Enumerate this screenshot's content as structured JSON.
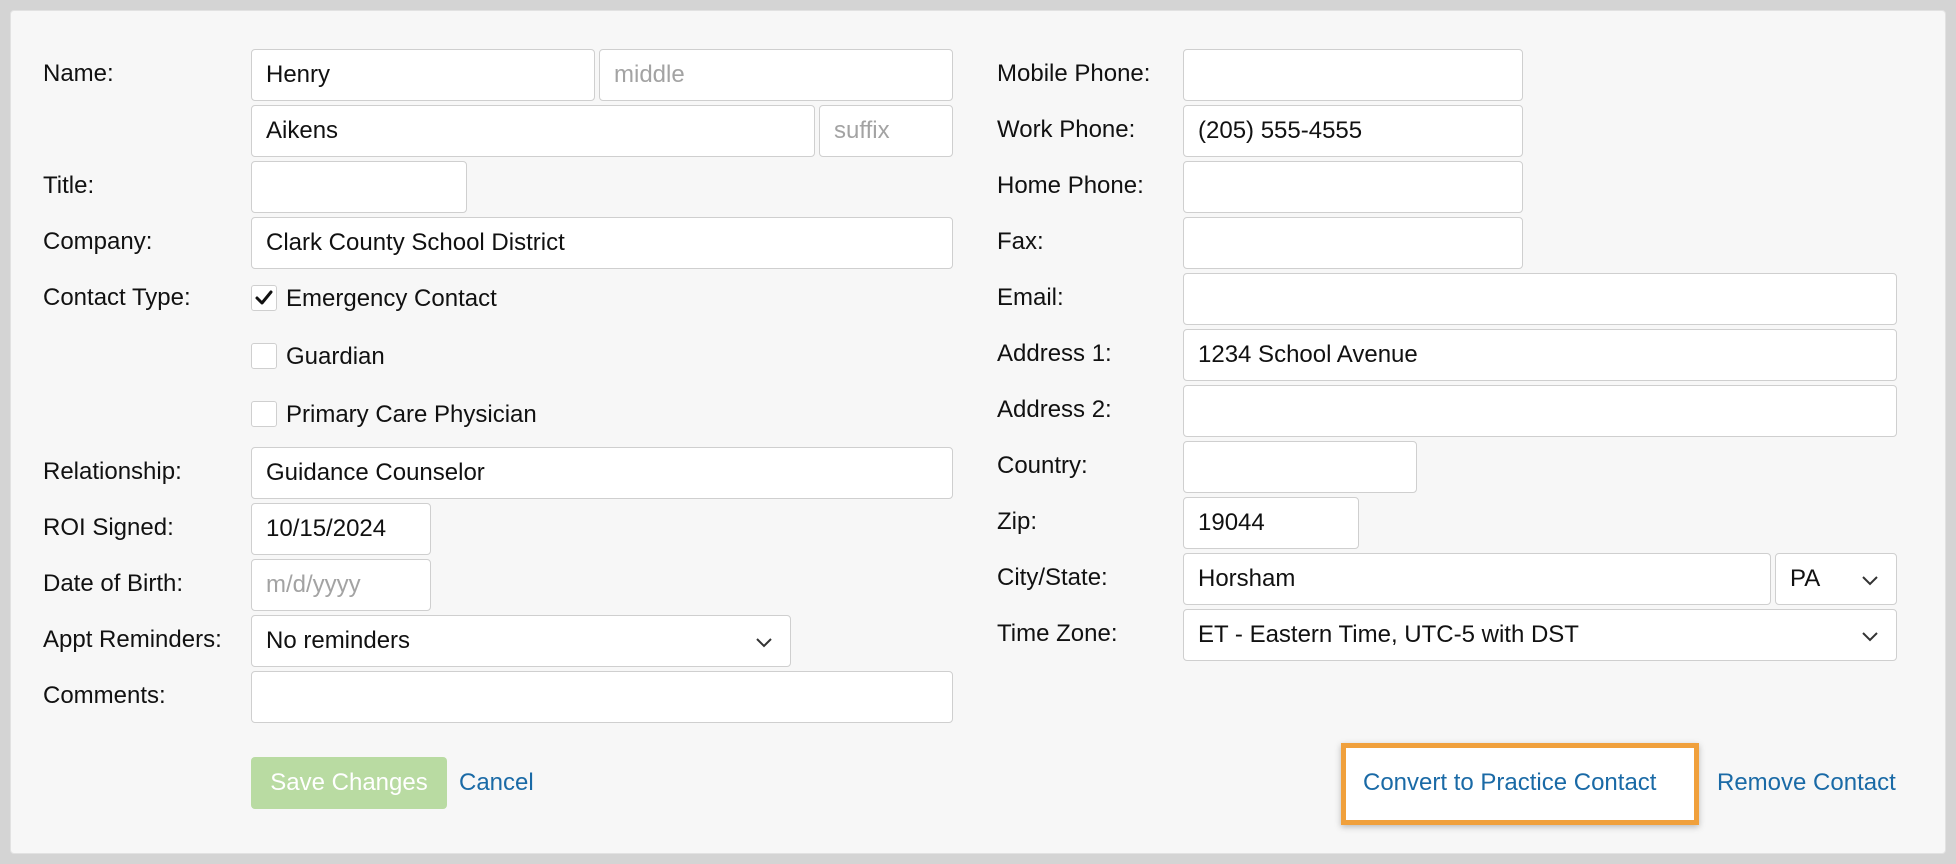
{
  "colors": {
    "accent_link": "#1a6aa6",
    "save_button_bg": "#b9dba2",
    "highlight_border": "#f0a03c"
  },
  "left": {
    "name_label": "Name:",
    "first_name": {
      "value": "Henry",
      "placeholder": ""
    },
    "middle_name": {
      "value": "",
      "placeholder": "middle"
    },
    "last_name": {
      "value": "Aikens",
      "placeholder": ""
    },
    "suffix": {
      "value": "",
      "placeholder": "suffix"
    },
    "title_label": "Title:",
    "title": {
      "value": ""
    },
    "company_label": "Company:",
    "company": {
      "value": "Clark County School District"
    },
    "contact_type_label": "Contact Type:",
    "contact_types": [
      {
        "label": "Emergency Contact",
        "checked": true
      },
      {
        "label": "Guardian",
        "checked": false
      },
      {
        "label": "Primary Care Physician",
        "checked": false
      }
    ],
    "relationship_label": "Relationship:",
    "relationship": {
      "value": "Guidance Counselor"
    },
    "roi_label": "ROI Signed:",
    "roi": {
      "value": "10/15/2024"
    },
    "dob_label": "Date of Birth:",
    "dob": {
      "value": "",
      "placeholder": "m/d/yyyy"
    },
    "reminders_label": "Appt Reminders:",
    "reminders": {
      "value": "No reminders"
    },
    "comments_label": "Comments:",
    "comments": {
      "value": ""
    }
  },
  "right": {
    "mobile_label": "Mobile Phone:",
    "mobile": {
      "value": ""
    },
    "work_label": "Work Phone:",
    "work": {
      "value": "(205) 555-4555"
    },
    "home_label": "Home Phone:",
    "home": {
      "value": ""
    },
    "fax_label": "Fax:",
    "fax": {
      "value": ""
    },
    "email_label": "Email:",
    "email": {
      "value": ""
    },
    "address1_label": "Address 1:",
    "address1": {
      "value": "1234 School Avenue"
    },
    "address2_label": "Address 2:",
    "address2": {
      "value": ""
    },
    "country_label": "Country:",
    "country": {
      "value": ""
    },
    "zip_label": "Zip:",
    "zip": {
      "value": "19044"
    },
    "city_state_label": "City/State:",
    "city": {
      "value": "Horsham"
    },
    "state": {
      "value": "PA"
    },
    "timezone_label": "Time Zone:",
    "timezone": {
      "value": "ET - Eastern Time, UTC-5 with DST"
    }
  },
  "actions": {
    "save_label": "Save Changes",
    "cancel_label": "Cancel",
    "convert_label": "Convert to Practice Contact",
    "remove_label": "Remove Contact"
  }
}
